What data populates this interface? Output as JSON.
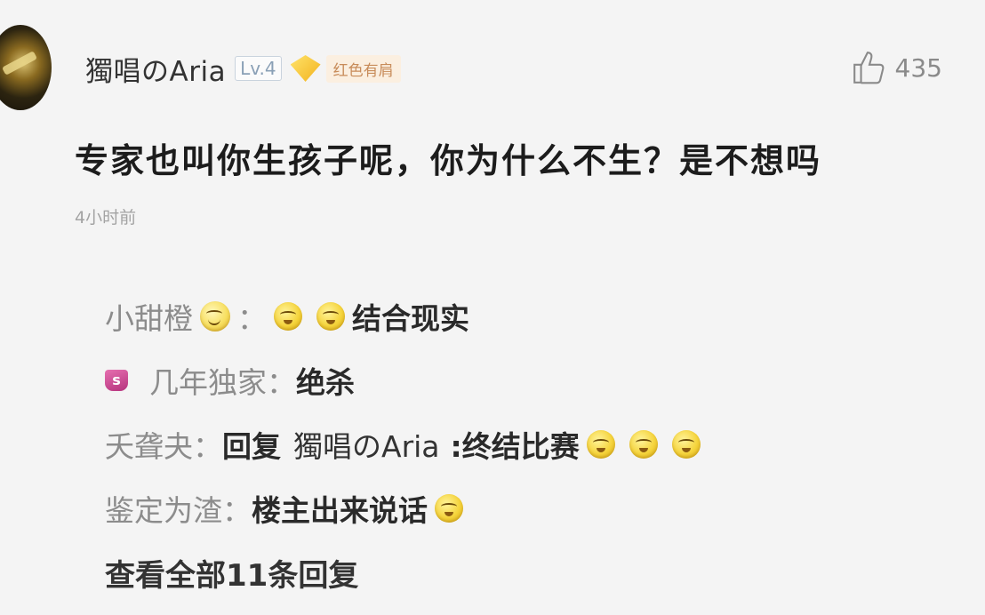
{
  "comment": {
    "username": "獨唱のAria",
    "level": "Lv.4",
    "badge_label": "红色有肩",
    "likes": "435",
    "text": "专家也叫你生孩子呢，你为什么不生？是不想吗",
    "time": "4小时前"
  },
  "replies": [
    {
      "name": "小甜橙",
      "sep": "：",
      "content": "结合现实",
      "name_icon": "smiling-face-emoji",
      "emoji_icon": "cringe-face-emoji"
    },
    {
      "name": "几年独家",
      "sep": "：",
      "content": "绝杀",
      "name_icon": "vip-badge-icon"
    },
    {
      "name": "夭聋夬",
      "sep": "：",
      "reply_label": "回复",
      "reply_target": "獨唱のAria",
      "content": ":终结比赛",
      "emoji_icon": "cringe-face-emoji"
    },
    {
      "name": "鉴定为渣",
      "sep": "：",
      "content": "楼主出来说话",
      "emoji_icon": "cringe-face-emoji"
    }
  ],
  "view_all": "查看全部11条回复",
  "colors": {
    "background": "#f4f4f4",
    "reply_name": "#8c8c8c",
    "badge_text": "#c88c5a"
  }
}
